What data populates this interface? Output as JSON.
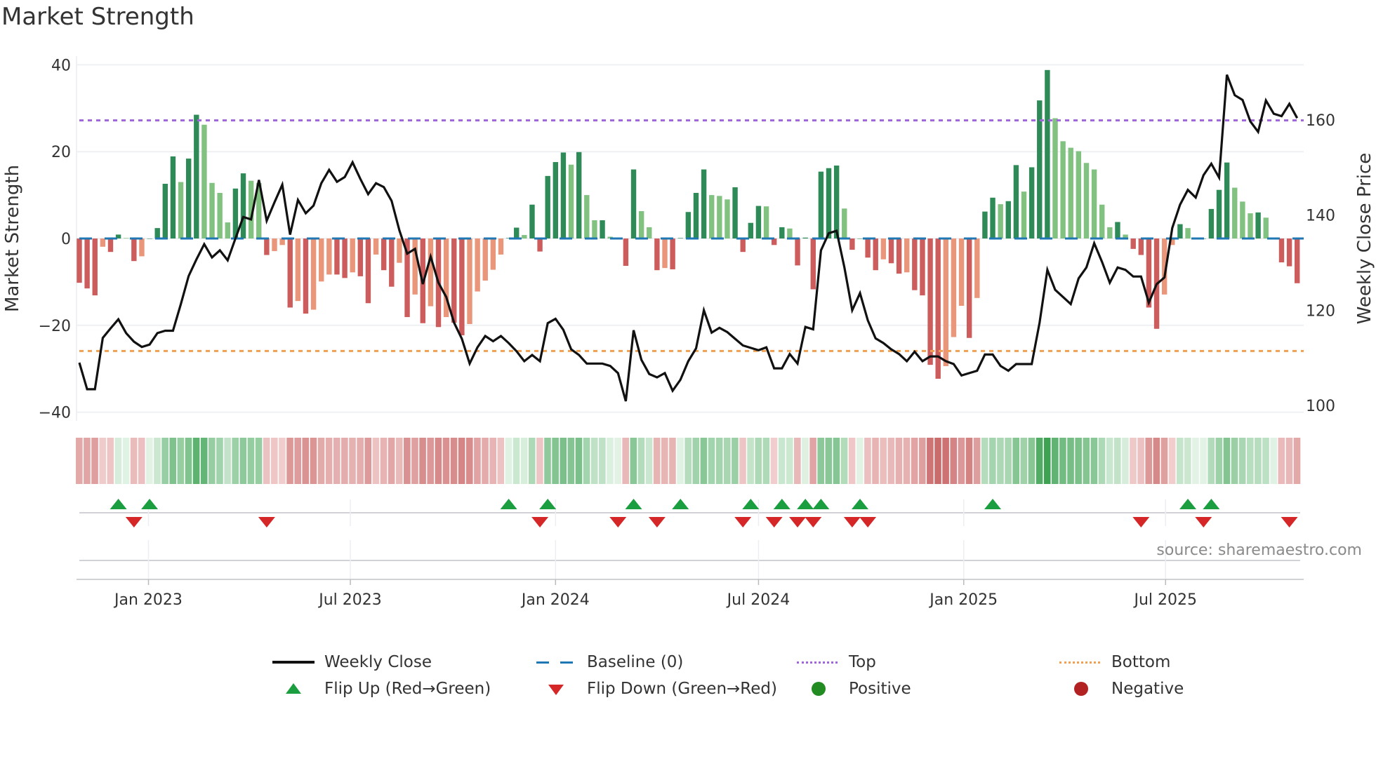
{
  "title": "Market Strength",
  "source": "source: sharemaestro.com",
  "colors": {
    "bar_pos_strong": "#2e8b57",
    "bar_pos_weak": "#81c281",
    "bar_neg_strong": "#cd5c5c",
    "bar_neg_weak": "#e9967a",
    "price_line": "#111111",
    "baseline": "#1f77b4",
    "top_line": "#a064dc",
    "bottom_line": "#f0a050",
    "flip_up": "#1a9e40",
    "flip_down": "#d62728",
    "positive": "#228b22",
    "negative": "#b22222",
    "grid": "#eef0f4"
  },
  "legend": [
    {
      "key": "weekly_close",
      "label": "Weekly Close"
    },
    {
      "key": "baseline",
      "label": "Baseline (0)"
    },
    {
      "key": "top",
      "label": "Top"
    },
    {
      "key": "bottom",
      "label": "Bottom"
    },
    {
      "key": "flip_up",
      "label": "Flip Up (Red→Green)"
    },
    {
      "key": "flip_down",
      "label": "Flip Down (Green→Red)"
    },
    {
      "key": "positive",
      "label": "Positive"
    },
    {
      "key": "negative",
      "label": "Negative"
    }
  ],
  "chart_data": {
    "type": "bar+line",
    "title": "Market Strength",
    "ylabel": "Market Strength",
    "y2label": "Weekly Close Price",
    "ylim": [
      -42,
      42
    ],
    "y2lim": [
      96.8,
      173.4
    ],
    "yticks": [
      40,
      20,
      0,
      -20,
      -40
    ],
    "ytick_labels": [
      "40",
      "20",
      "0",
      "−20",
      "−40"
    ],
    "y2ticks": [
      160,
      140,
      120,
      100
    ],
    "y2tick_labels": [
      "160",
      "140",
      "120",
      "100"
    ],
    "x_start_date": "2022-10-31",
    "x_interval_days": 7,
    "xticks": [
      {
        "date": "2023-01-01",
        "label": "Jan 2023"
      },
      {
        "date": "2023-07-01",
        "label": "Jul 2023"
      },
      {
        "date": "2024-01-01",
        "label": "Jan 2024"
      },
      {
        "date": "2024-07-01",
        "label": "Jul 2024"
      },
      {
        "date": "2025-01-01",
        "label": "Jan 2025"
      },
      {
        "date": "2025-07-01",
        "label": "Jul 2025"
      }
    ],
    "top_level": 27.2,
    "bottom_level": -25.9,
    "baseline": 0,
    "strength": [
      -10.2,
      -11.5,
      -13.1,
      -1.9,
      -3.1,
      0.9,
      0.1,
      -5.2,
      -4.1,
      0,
      2.4,
      12.6,
      18.9,
      13.0,
      18.4,
      28.5,
      26.2,
      12.8,
      10.5,
      3.7,
      11.5,
      15.0,
      13.3,
      12.8,
      -3.8,
      -2.9,
      -1.5,
      -15.9,
      -14.4,
      -17.3,
      -16.4,
      -9.9,
      -8.3,
      -8.3,
      -9.1,
      -7.8,
      -8.7,
      -14.9,
      -3.7,
      -7.3,
      -11.1,
      -5.6,
      -18.1,
      -12.9,
      -19.5,
      -15.6,
      -20.4,
      -18.1,
      -19.4,
      -22.3,
      -19.7,
      -12.2,
      -9.7,
      -7.2,
      -3.7,
      0.1,
      2.5,
      0.8,
      7.8,
      -3.0,
      14.4,
      17.6,
      19.8,
      17.0,
      19.9,
      10.0,
      4.2,
      4.2,
      0.4,
      0,
      -6.3,
      15.9,
      6.3,
      2.6,
      -7.3,
      -6.8,
      -7.1,
      0.1,
      6.1,
      10.5,
      15.9,
      10.0,
      9.8,
      9.0,
      11.8,
      -3.1,
      3.6,
      7.5,
      7.4,
      -1.5,
      2.6,
      2.3,
      -6.2,
      0.2,
      -11.7,
      15.4,
      16.2,
      16.8,
      6.9,
      -2.6,
      0,
      -4.4,
      -7.3,
      -4.8,
      -5.7,
      -8.1,
      -7.8,
      -11.9,
      -13.1,
      -29.1,
      -32.3,
      -29.4,
      -22.7,
      -15.5,
      -22.9,
      -13.7,
      6.2,
      9.4,
      7.9,
      8.6,
      16.9,
      10.8,
      16.4,
      31.8,
      38.8,
      27.7,
      22.4,
      20.9,
      20.1,
      17.4,
      15.9,
      7.8,
      2.6,
      3.8,
      0.9,
      -2.4,
      -3.8,
      -15.9,
      -20.8,
      -12.9,
      -1.5,
      3.3,
      2.4,
      0,
      0,
      6.8,
      11.2,
      17.5,
      11.7,
      8.5,
      5.8,
      6.0,
      4.8,
      0.1,
      -5.5,
      -6.4,
      -10.3
    ],
    "weekly_close": [
      109.0,
      103.4,
      103.4,
      114.2,
      116.2,
      118.1,
      115.2,
      113.4,
      112.3,
      112.8,
      115.2,
      115.7,
      115.7,
      121.3,
      127.2,
      130.7,
      133.9,
      131.1,
      132.6,
      130.5,
      135.1,
      139.6,
      139.1,
      147.4,
      138.8,
      142.7,
      146.4,
      135.9,
      143.2,
      140.4,
      142.0,
      146.7,
      149.5,
      147.0,
      148.0,
      151.1,
      147.6,
      144.4,
      146.7,
      145.9,
      143.0,
      136.8,
      131.9,
      132.9,
      125.5,
      131.3,
      125.8,
      122.8,
      117.4,
      114.0,
      108.8,
      112.2,
      114.6,
      113.5,
      114.6,
      113.1,
      111.4,
      109.3,
      110.6,
      109.3,
      117.3,
      118.2,
      115.9,
      111.8,
      110.6,
      108.8,
      108.8,
      108.8,
      108.3,
      106.8,
      100.9,
      115.8,
      109.6,
      106.6,
      105.9,
      106.8,
      103.1,
      105.4,
      109.3,
      112.0,
      120.0,
      115.3,
      116.3,
      115.4,
      114.0,
      112.6,
      112.1,
      111.6,
      112.2,
      107.8,
      107.8,
      110.8,
      108.8,
      116.5,
      116.0,
      132.6,
      136.2,
      136.7,
      129.0,
      120.0,
      123.6,
      117.9,
      114.1,
      113.1,
      111.8,
      110.8,
      109.3,
      111.3,
      109.3,
      110.3,
      110.3,
      109.3,
      108.7,
      106.3,
      106.8,
      107.3,
      110.7,
      110.7,
      108.3,
      107.3,
      108.7,
      108.7,
      108.7,
      117.4,
      128.5,
      124.3,
      122.8,
      121.3,
      126.7,
      129.0,
      134.1,
      130.2,
      125.8,
      129.0,
      128.5,
      127.1,
      127.1,
      121.6,
      125.5,
      126.9,
      137.3,
      142.2,
      145.3,
      143.7,
      148.4,
      150.8,
      147.9,
      169.5,
      165.2,
      164.2,
      159.7,
      157.5,
      164.1,
      161.3,
      160.8,
      163.4,
      160.4
    ],
    "flip_up_weeks": [
      6,
      10,
      56,
      61,
      72,
      78,
      87,
      91,
      94,
      96,
      101,
      118,
      143,
      146
    ],
    "flip_down_weeks": [
      8,
      25,
      60,
      70,
      75,
      86,
      90,
      93,
      95,
      100,
      102,
      137,
      145,
      156
    ],
    "legend_position": "bottom"
  }
}
